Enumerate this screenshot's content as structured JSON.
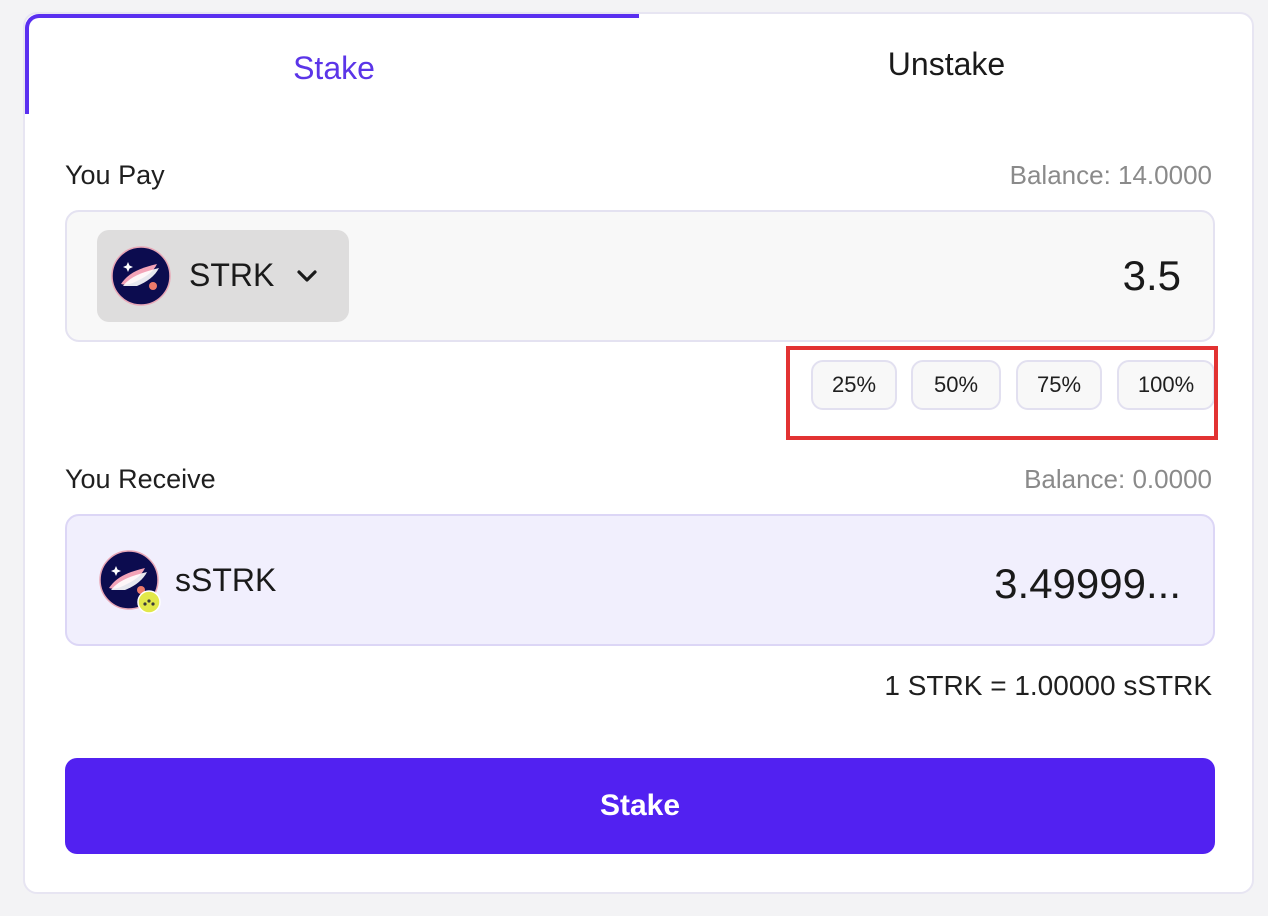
{
  "tabs": [
    {
      "label": "Stake",
      "active": true
    },
    {
      "label": "Unstake",
      "active": false
    }
  ],
  "pay": {
    "label": "You Pay",
    "balance": "Balance: 14.0000",
    "token": "STRK",
    "token_icon": "starknet-logo-icon",
    "amount": "3.5"
  },
  "percent_buttons": [
    "25%",
    "50%",
    "75%",
    "100%"
  ],
  "receive": {
    "label": "You Receive",
    "balance": "Balance: 0.0000",
    "token": "sSTRK",
    "token_icon": "starknet-logo-icon",
    "amount": "3.49999..."
  },
  "rate": "1 STRK = 1.00000 sSTRK",
  "submit_label": "Stake",
  "colors": {
    "accent": "#5221f1",
    "active_tab": "#5b35e8",
    "highlight": "#e23232",
    "receive_bg": "#f1effd"
  }
}
